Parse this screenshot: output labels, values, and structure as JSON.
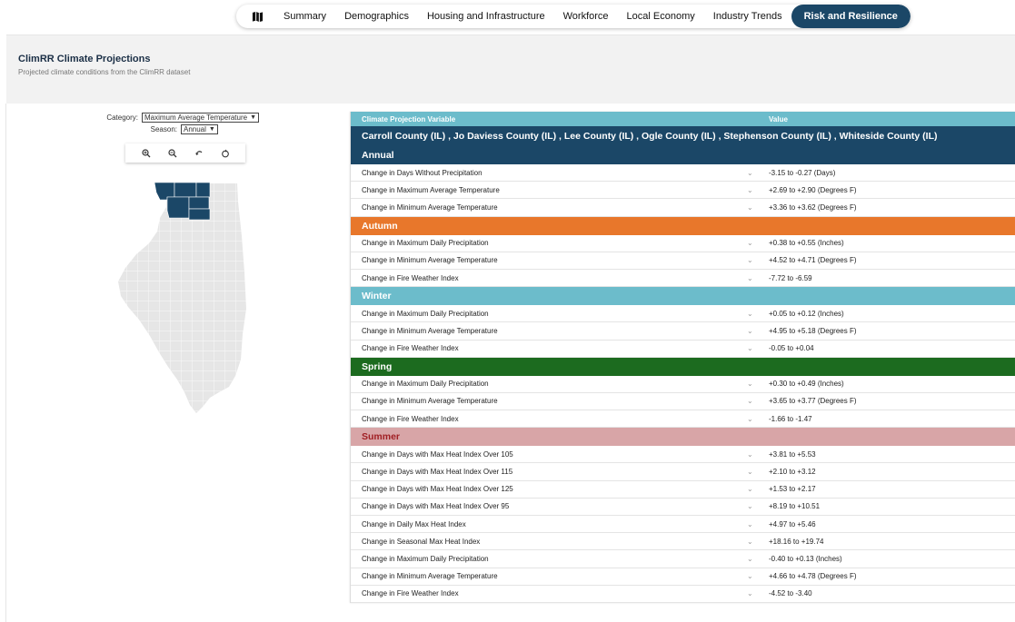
{
  "nav": {
    "tabs": [
      {
        "label": "Summary"
      },
      {
        "label": "Demographics"
      },
      {
        "label": "Housing and Infrastructure"
      },
      {
        "label": "Workforce"
      },
      {
        "label": "Local Economy"
      },
      {
        "label": "Industry Trends"
      },
      {
        "label": "Risk and Resilience"
      }
    ],
    "active_tab": "Risk and Resilience",
    "map_icon": "map-icon"
  },
  "header": {
    "title": "ClimRR Climate Projections",
    "subtitle": "Projected climate conditions from the ClimRR dataset"
  },
  "controls": {
    "category_label": "Category:",
    "category_value": "Maximum Average Temperature",
    "season_label": "Season:",
    "season_value": "Annual",
    "tools": [
      "zoom-in-icon",
      "zoom-out-icon",
      "undo-icon",
      "reset-icon"
    ]
  },
  "map": {
    "state": "Illinois",
    "highlight_color": "#1b4767",
    "base_color": "#e6e6e6"
  },
  "table": {
    "headers": {
      "variable": "Climate Projection Variable",
      "value": "Value"
    },
    "counties": "Carroll County (IL) , Jo Daviess County (IL) , Lee County (IL) , Ogle County (IL) , Stephenson County (IL) , Whiteside County (IL)",
    "sections": [
      {
        "name": "Annual",
        "color": "#1b4767",
        "text_color": "#ffffff",
        "rows": [
          {
            "variable": "Change in Days Without Precipitation",
            "value": "-3.15 to -0.27 (Days)"
          },
          {
            "variable": "Change in Maximum Average Temperature",
            "value": "+2.69 to +2.90 (Degrees F)"
          },
          {
            "variable": "Change in Minimum Average Temperature",
            "value": "+3.36 to +3.62 (Degrees F)"
          }
        ]
      },
      {
        "name": "Autumn",
        "color": "#e8772b",
        "text_color": "#ffffff",
        "rows": [
          {
            "variable": "Change in Maximum Daily Precipitation",
            "value": "+0.38 to +0.55 (Inches)"
          },
          {
            "variable": "Change in Minimum Average Temperature",
            "value": "+4.52 to +4.71 (Degrees F)"
          },
          {
            "variable": "Change in Fire Weather Index",
            "value": "-7.72 to -6.59"
          }
        ]
      },
      {
        "name": "Winter",
        "color": "#6cbccb",
        "text_color": "#ffffff",
        "rows": [
          {
            "variable": "Change in Maximum Daily Precipitation",
            "value": "+0.05 to +0.12 (Inches)"
          },
          {
            "variable": "Change in Minimum Average Temperature",
            "value": "+4.95 to +5.18 (Degrees F)"
          },
          {
            "variable": "Change in Fire Weather Index",
            "value": "-0.05 to +0.04"
          }
        ]
      },
      {
        "name": "Spring",
        "color": "#1c6b1f",
        "text_color": "#ffffff",
        "rows": [
          {
            "variable": "Change in Maximum Daily Precipitation",
            "value": "+0.30 to +0.49 (Inches)"
          },
          {
            "variable": "Change in Minimum Average Temperature",
            "value": "+3.65 to +3.77 (Degrees F)"
          },
          {
            "variable": "Change in Fire Weather Index",
            "value": "-1.66 to -1.47"
          }
        ]
      },
      {
        "name": "Summer",
        "color": "#d8a5a7",
        "text_color": "#a01f24",
        "rows": [
          {
            "variable": "Change in Days with Max Heat Index Over 105",
            "value": "+3.81 to +5.53"
          },
          {
            "variable": "Change in Days with Max Heat Index Over 115",
            "value": "+2.10 to +3.12"
          },
          {
            "variable": "Change in Days with Max Heat Index Over 125",
            "value": "+1.53 to +2.17"
          },
          {
            "variable": "Change in Days with Max Heat Index Over 95",
            "value": "+8.19 to +10.51"
          },
          {
            "variable": "Change in Daily Max Heat Index",
            "value": "+4.97 to +5.46"
          },
          {
            "variable": "Change in Seasonal Max Heat Index",
            "value": "+18.16 to +19.74"
          },
          {
            "variable": "Change in Maximum Daily Precipitation",
            "value": "-0.40 to +0.13 (Inches)"
          },
          {
            "variable": "Change in Minimum Average Temperature",
            "value": "+4.66 to +4.78 (Degrees F)"
          },
          {
            "variable": "Change in Fire Weather Index",
            "value": "-4.52 to -3.40"
          }
        ]
      }
    ]
  }
}
